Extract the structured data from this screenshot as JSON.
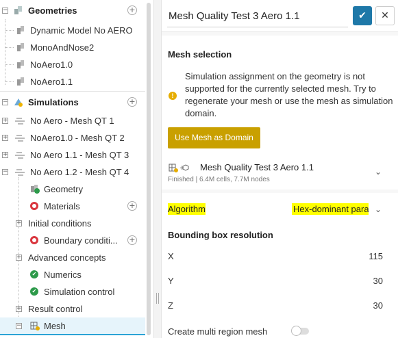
{
  "tree": {
    "geometries_label": "Geometries",
    "geometries": [
      "Dynamic Model No AERO",
      "MonoAndNose2",
      "NoAero1.0",
      "NoAero1.1"
    ],
    "simulations_label": "Simulations",
    "simulations": [
      "No Aero - Mesh QT 1",
      "NoAero1.0 - Mesh QT 2",
      "No Aero 1.1 - Mesh QT 3",
      "No Aero 1.2 - Mesh QT 4"
    ],
    "children": {
      "geometry": "Geometry",
      "materials": "Materials",
      "initial_conditions": "Initial conditions",
      "boundary_conditions": "Boundary conditi...",
      "advanced_concepts": "Advanced concepts",
      "numerics": "Numerics",
      "simulation_control": "Simulation control",
      "result_control": "Result control",
      "mesh": "Mesh"
    }
  },
  "panel": {
    "title_value": "Mesh Quality Test 3 Aero 1.1",
    "mesh_selection_title": "Mesh selection",
    "warning_text": "Simulation assignment on the geometry is not supported for the currently selected mesh. Try to regenerate your mesh or use the mesh as simulation domain.",
    "use_mesh_button": "Use Mesh as Domain",
    "selected_mesh_name": "Mesh Quality Test 3 Aero 1.1",
    "selected_mesh_meta": "Finished | 6.4M cells, 7.7M nodes",
    "algorithm_label": "Algorithm",
    "algorithm_value": "Hex-dominant parametric",
    "bbox_title": "Bounding box resolution",
    "x_label": "X",
    "x_value": "115",
    "y_label": "Y",
    "y_value": "30",
    "z_label": "Z",
    "z_value": "30",
    "multi_region_label": "Create multi region mesh"
  },
  "colors": {
    "accent": "#1e78a8",
    "warning": "#c9a000",
    "highlight": "#ffff00",
    "status_error": "#d9363e",
    "status_ok": "#2d9a4a"
  }
}
